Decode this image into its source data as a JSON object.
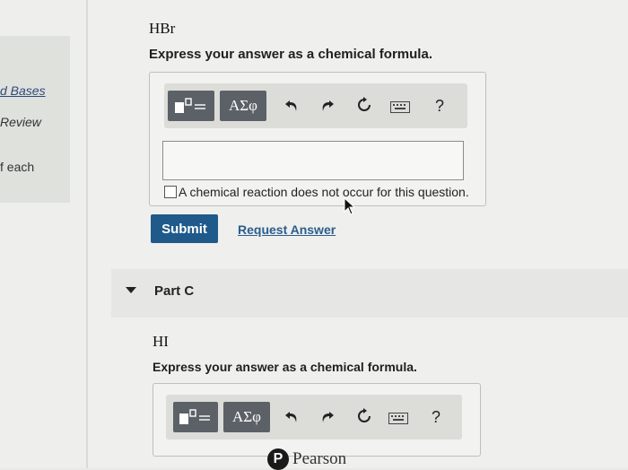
{
  "sidebar": {
    "link_bases": "d Bases",
    "review": "Review",
    "of_each": "f each"
  },
  "partB": {
    "compound": "HBr",
    "instruction": "Express your answer as a chemical formula.",
    "toolbar": {
      "template_icon": "fraction-template-icon",
      "greek_label": "ΑΣφ",
      "undo_icon": "undo-icon",
      "redo_icon": "redo-icon",
      "reset_icon": "reset-icon",
      "keyboard_icon": "keyboard-icon",
      "help_label": "?"
    },
    "answer_value": "",
    "no_reaction_label": "A chemical reaction does not occur for this question.",
    "submit_label": "Submit",
    "request_answer_label": "Request Answer"
  },
  "partC": {
    "label": "Part C",
    "compound": "HI",
    "instruction": "Express your answer as a chemical formula.",
    "toolbar": {
      "greek_label": "ΑΣφ",
      "help_label": "?"
    }
  },
  "footer": {
    "brand": "Pearson",
    "logo_letter": "P"
  },
  "colors": {
    "submit_bg": "#1f5a8a",
    "toolbar_button": "#5c6168",
    "link": "#2b5d8e"
  }
}
